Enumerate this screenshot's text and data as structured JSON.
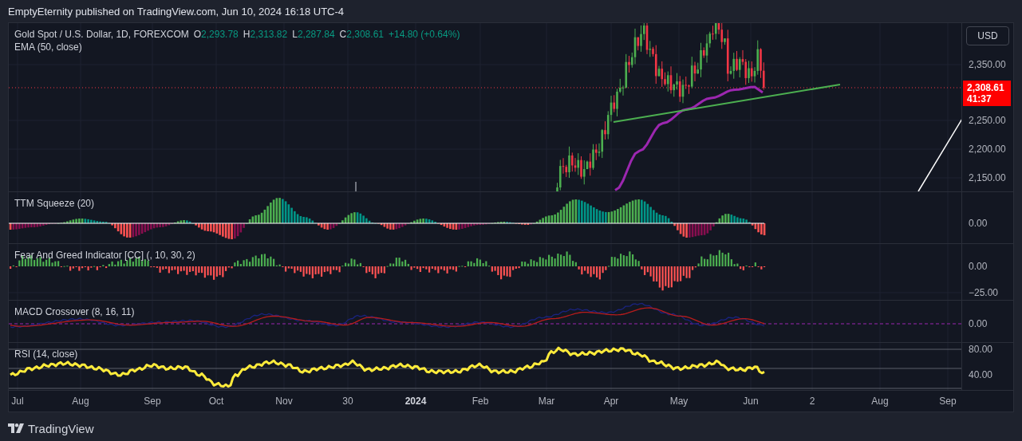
{
  "header": {
    "caption": "EmptyEternity published on TradingView.com, Jun 10, 2024 16:18 UTC-4"
  },
  "main_pane": {
    "symbol": "Gold Spot / U.S. Dollar, 1D, FOREXCOM",
    "ohlc": [
      {
        "key": "O",
        "value": "2,293.78"
      },
      {
        "key": "H",
        "value": "2,313.82"
      },
      {
        "key": "L",
        "value": "2,287.84"
      },
      {
        "key": "C",
        "value": "2,308.61"
      }
    ],
    "change": "+14.80 (+0.64%)",
    "studies": [
      "EMA (50, close)"
    ],
    "currency_button": "USD",
    "axis_labels": [
      "2,350.00",
      "2,250.00",
      "2,200.00",
      "2,150.00"
    ],
    "last_price": {
      "price": "2,308.61",
      "countdown": "41:37"
    }
  },
  "indicator_panes": [
    {
      "kind": "squeeze",
      "title": "TTM Squeeze (20)",
      "axis_labels": [
        "0.00"
      ]
    },
    {
      "kind": "fear_greed",
      "title": "Fear And Greed Indicator [CC] (, 10, 30, 2)",
      "axis_labels": [
        "0.00",
        "−25.00"
      ]
    },
    {
      "kind": "macd",
      "title": "MACD Crossover (8, 16, 11)",
      "axis_labels": [
        "0.00"
      ]
    },
    {
      "kind": "rsi",
      "title": "RSI (14, close)",
      "axis_labels": [
        "80.00",
        "40.00"
      ]
    }
  ],
  "time_axis": [
    {
      "text": "Jul",
      "bold": false
    },
    {
      "text": "Aug",
      "bold": false
    },
    {
      "text": "Sep",
      "bold": false
    },
    {
      "text": "Oct",
      "bold": false
    },
    {
      "text": "Nov",
      "bold": false
    },
    {
      "text": "30",
      "bold": false
    },
    {
      "text": "2024",
      "bold": true
    },
    {
      "text": "Feb",
      "bold": false
    },
    {
      "text": "Mar",
      "bold": false
    },
    {
      "text": "Apr",
      "bold": false
    },
    {
      "text": "May",
      "bold": false
    },
    {
      "text": "Jun",
      "bold": false
    },
    {
      "text": "2",
      "bold": false
    },
    {
      "text": "Aug",
      "bold": false
    },
    {
      "text": "Sep",
      "bold": false
    }
  ],
  "footer": {
    "logo": "TradingView"
  }
}
